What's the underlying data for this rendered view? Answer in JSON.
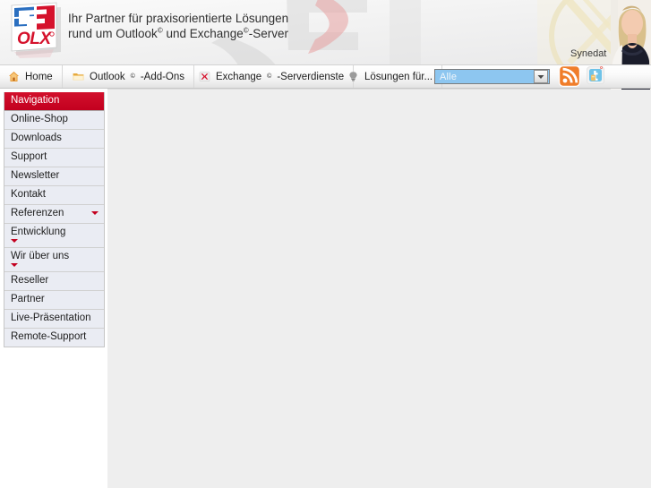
{
  "header": {
    "logo_text": "OLX",
    "tagline_line1": "Ihr Partner für praxisorientierte Lösungen",
    "tagline_line2_pre": "rund um Outlook",
    "tagline_line2_mid": " und Exchange",
    "tagline_line2_post": "-Server",
    "sup": "©",
    "brand_name": "Synedat",
    "colors": {
      "brand_red": "#c3001f",
      "header_bg": "#f2f2f2",
      "accent_blue": "#8dc6f0"
    }
  },
  "menubar": {
    "items": [
      {
        "label": "Home",
        "icon": "house-icon",
        "sup": "",
        "suffix": ""
      },
      {
        "label": "Outlook",
        "icon": "folder-icon",
        "sup": "©",
        "suffix": "-Add-Ons"
      },
      {
        "label": "Exchange",
        "icon": "exchange-icon",
        "sup": "©",
        "suffix": "-Serverdienste"
      },
      {
        "label": "Lösungen für...",
        "icon": "lightbulb-icon",
        "sup": "",
        "suffix": ""
      }
    ],
    "search_scope": {
      "selected": "Alle",
      "options": [
        "Alle"
      ],
      "arrow_icon": "chevron-down-icon"
    },
    "social": [
      {
        "name": "rss-icon",
        "label": "RSS"
      },
      {
        "name": "twitter-icon",
        "label": "Twitter"
      }
    ]
  },
  "sidebar": {
    "title": "Navigation",
    "items": [
      {
        "label": "Online-Shop",
        "caret": false
      },
      {
        "label": "Downloads",
        "caret": false
      },
      {
        "label": "Support",
        "caret": false
      },
      {
        "label": "Newsletter",
        "caret": false
      },
      {
        "label": "Kontakt",
        "caret": false
      },
      {
        "label": "Referenzen",
        "caret": true
      },
      {
        "label": "Entwicklung",
        "caret": true,
        "wrapped": true
      },
      {
        "label": "Wir über uns",
        "caret": true,
        "wrapped": true
      },
      {
        "label": "Reseller",
        "caret": false
      },
      {
        "label": "Partner",
        "caret": false
      },
      {
        "label": "Live-Präsentation",
        "caret": false
      },
      {
        "label": "Remote-Support",
        "caret": false
      }
    ]
  },
  "main": {
    "content": ""
  }
}
